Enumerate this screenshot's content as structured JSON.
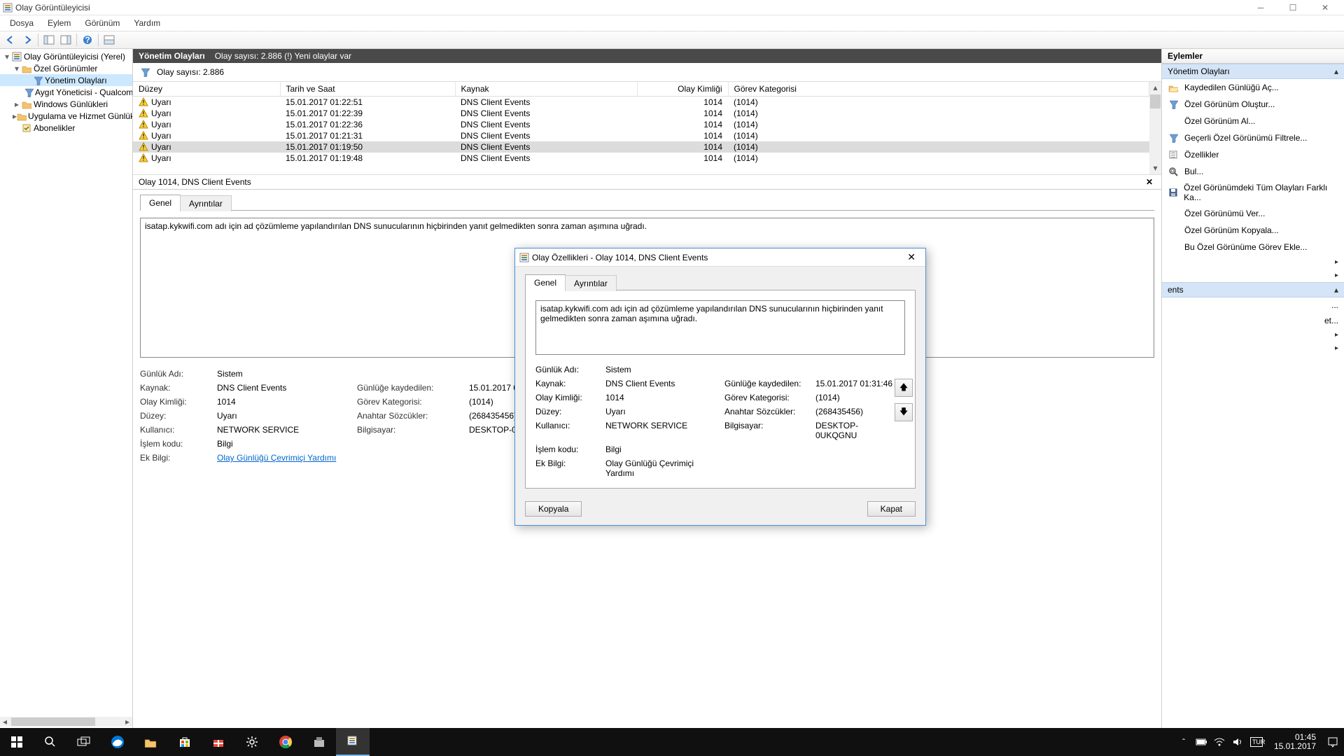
{
  "window": {
    "title": "Olay Görüntüleyicisi",
    "menus": [
      "Dosya",
      "Eylem",
      "Görünüm",
      "Yardım"
    ]
  },
  "tree": {
    "root": "Olay Görüntüleyicisi (Yerel)",
    "nodes": [
      {
        "label": "Özel Görünümler",
        "icon": "folder",
        "indent": 1,
        "exp": "−"
      },
      {
        "label": "Yönetim Olayları",
        "icon": "funnel",
        "indent": 2,
        "selected": true
      },
      {
        "label": "Aygıt Yöneticisi - Qualcomm",
        "icon": "funnel",
        "indent": 2
      },
      {
        "label": "Windows Günlükleri",
        "icon": "folder",
        "indent": 1,
        "exp": "+"
      },
      {
        "label": "Uygulama ve Hizmet Günlükleri",
        "icon": "folder",
        "indent": 1,
        "exp": "+"
      },
      {
        "label": "Abonelikler",
        "icon": "sub",
        "indent": 1
      }
    ]
  },
  "center": {
    "header_title": "Yönetim Olayları",
    "header_sub": "Olay sayısı: 2.886 (!) Yeni olaylar var",
    "filter_count": "Olay sayısı: 2.886",
    "columns": [
      "Düzey",
      "Tarih ve Saat",
      "Kaynak",
      "Olay Kimliği",
      "Görev Kategorisi"
    ],
    "rows": [
      {
        "level": "Uyarı",
        "dt": "15.01.2017 01:22:51",
        "src": "DNS Client Events",
        "id": "1014",
        "cat": "(1014)"
      },
      {
        "level": "Uyarı",
        "dt": "15.01.2017 01:22:39",
        "src": "DNS Client Events",
        "id": "1014",
        "cat": "(1014)"
      },
      {
        "level": "Uyarı",
        "dt": "15.01.2017 01:22:36",
        "src": "DNS Client Events",
        "id": "1014",
        "cat": "(1014)"
      },
      {
        "level": "Uyarı",
        "dt": "15.01.2017 01:21:31",
        "src": "DNS Client Events",
        "id": "1014",
        "cat": "(1014)"
      },
      {
        "level": "Uyarı",
        "dt": "15.01.2017 01:19:50",
        "src": "DNS Client Events",
        "id": "1014",
        "cat": "(1014)",
        "sel": true
      },
      {
        "level": "Uyarı",
        "dt": "15.01.2017 01:19:48",
        "src": "DNS Client Events",
        "id": "1014",
        "cat": "(1014)"
      }
    ]
  },
  "detail": {
    "title": "Olay 1014, DNS Client Events",
    "tabs": [
      "Genel",
      "Ayrıntılar"
    ],
    "message": "isatap.kykwifi.com adı için ad çözümleme yapılandırılan DNS sunucularının hiçbirinden yanıt gelmedikten sonra zaman aşımına uğradı.",
    "props": {
      "log_name_lbl": "Günlük Adı:",
      "log_name": "Sistem",
      "source_lbl": "Kaynak:",
      "source": "DNS Client Events",
      "logged_lbl": "Günlüğe kaydedilen:",
      "logged": "15.01.2017 01:19:50",
      "event_id_lbl": "Olay Kimliği:",
      "event_id": "1014",
      "task_cat_lbl": "Görev Kategorisi:",
      "task_cat": "(1014)",
      "level_lbl": "Düzey:",
      "level": "Uyarı",
      "keywords_lbl": "Anahtar Sözcükler:",
      "keywords": "(268435456)",
      "user_lbl": "Kullanıcı:",
      "user": "NETWORK SERVICE",
      "computer_lbl": "Bilgisayar:",
      "computer": "DESKTOP-0UKQGNU",
      "opcode_lbl": "İşlem kodu:",
      "opcode": "Bilgi",
      "moreinfo_lbl": "Ek Bilgi:",
      "moreinfo": "Olay Günlüğü Çevrimiçi Yardımı"
    }
  },
  "actions": {
    "header": "Eylemler",
    "group1": "Yönetim Olayları",
    "items1": [
      {
        "icon": "open",
        "label": "Kaydedilen Günlüğü Aç..."
      },
      {
        "icon": "funnel",
        "label": "Özel Görünüm Oluştur..."
      },
      {
        "icon": "",
        "label": "Özel Görünüm Al..."
      },
      {
        "icon": "funnel",
        "label": "Geçerli Özel Görünümü Filtrele..."
      },
      {
        "icon": "props",
        "label": "Özellikler"
      },
      {
        "icon": "find",
        "label": "Bul..."
      },
      {
        "icon": "save",
        "label": "Özel Görünümdeki Tüm Olayları Farklı Ka..."
      },
      {
        "icon": "",
        "label": "Özel Görünümü Ver..."
      },
      {
        "icon": "",
        "label": "Özel Görünüm Kopyala..."
      },
      {
        "icon": "",
        "label": "Bu Özel Görünüme Görev Ekle..."
      }
    ],
    "group2": "ents"
  },
  "dialog": {
    "title": "Olay Özellikleri - Olay 1014, DNS Client Events",
    "tabs": [
      "Genel",
      "Ayrıntılar"
    ],
    "message": "isatap.kykwifi.com adı için ad çözümleme yapılandırılan DNS sunucularının hiçbirinden yanıt gelmedikten sonra zaman aşımına uğradı.",
    "props": {
      "log_name_lbl": "Günlük Adı:",
      "log_name": "Sistem",
      "source_lbl": "Kaynak:",
      "source": "DNS Client Events",
      "logged_lbl": "Günlüğe kaydedilen:",
      "logged": "15.01.2017 01:31:46",
      "event_id_lbl": "Olay Kimliği:",
      "event_id": "1014",
      "task_cat_lbl": "Görev Kategorisi:",
      "task_cat": "(1014)",
      "level_lbl": "Düzey:",
      "level": "Uyarı",
      "keywords_lbl": "Anahtar Sözcükler:",
      "keywords": "(268435456)",
      "user_lbl": "Kullanıcı:",
      "user": "NETWORK SERVICE",
      "computer_lbl": "Bilgisayar:",
      "computer": "DESKTOP-0UKQGNU",
      "opcode_lbl": "İşlem kodu:",
      "opcode": "Bilgi",
      "moreinfo_lbl": "Ek Bilgi:",
      "moreinfo": "Olay Günlüğü Çevrimiçi Yardımı"
    },
    "copy_btn": "Kopyala",
    "close_btn": "Kapat"
  },
  "taskbar": {
    "time": "01:45",
    "date": "15.01.2017"
  }
}
